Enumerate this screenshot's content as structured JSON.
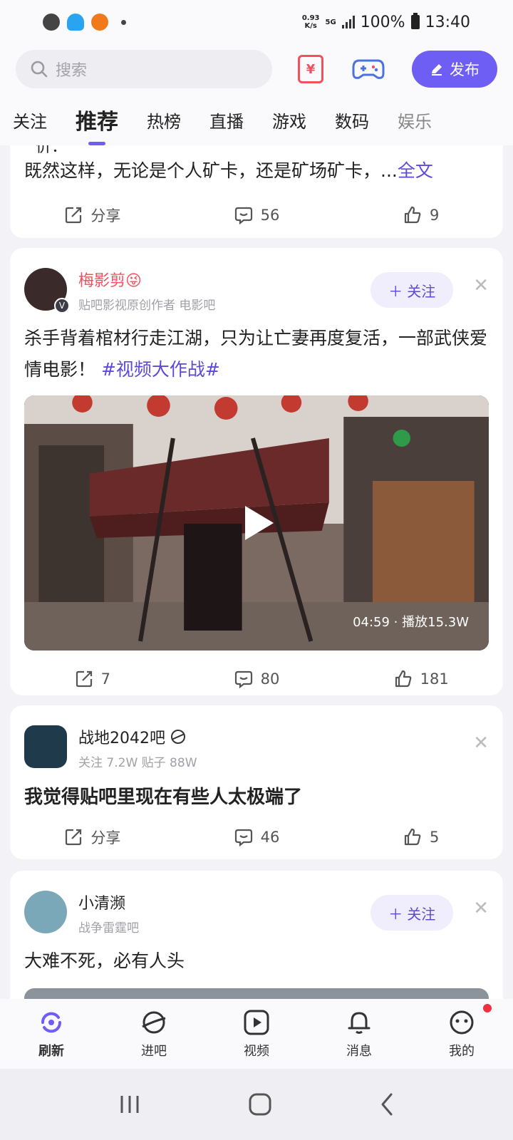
{
  "status_bar": {
    "net_speed_value": "0.93",
    "net_speed_unit": "K/s",
    "network": "5G",
    "battery": "100%",
    "time": "13:40"
  },
  "header": {
    "search_placeholder": "搜索",
    "ticket_symbol": "¥",
    "publish_label": "发布"
  },
  "tabs": [
    "关注",
    "推荐",
    "热榜",
    "直播",
    "游戏",
    "数码",
    "娱乐"
  ],
  "active_tab": "推荐",
  "feed": {
    "card0": {
      "clipped_text": "价：",
      "text": "既然这样，无论是个人矿卡，还是矿场矿卡，...",
      "more_link": "全文",
      "share_label": "分享",
      "comments": "56",
      "likes": "9"
    },
    "card1": {
      "author": "梅影剪😜",
      "subtitle": "贴吧影视原创作者  电影吧",
      "follow_label": "关注",
      "text": "杀手背着棺材行走江湖，只为让亡妻再度复活，一部武侠爱情电影！",
      "tag": "#视频大作战#",
      "video_info": "04:59 · 播放15.3W",
      "shares": "7",
      "comments": "80",
      "likes": "181"
    },
    "card2": {
      "forum": "战地2042吧",
      "stats": "关注 7.2W   贴子 88W",
      "title": "我觉得贴吧里现在有些人太极端了",
      "share_label": "分享",
      "comments": "46",
      "likes": "5"
    },
    "card3": {
      "author": "小清濒",
      "subtitle": "战争雷霆吧",
      "follow_label": "关注",
      "text": "大难不死，必有人头"
    }
  },
  "bottom_nav": [
    "刷新",
    "进吧",
    "视频",
    "消息",
    "我的"
  ],
  "colors": {
    "accent": "#6e5ef3",
    "link": "#5b4ad9",
    "author_red": "#f0505f",
    "notification": "#f0303f"
  }
}
